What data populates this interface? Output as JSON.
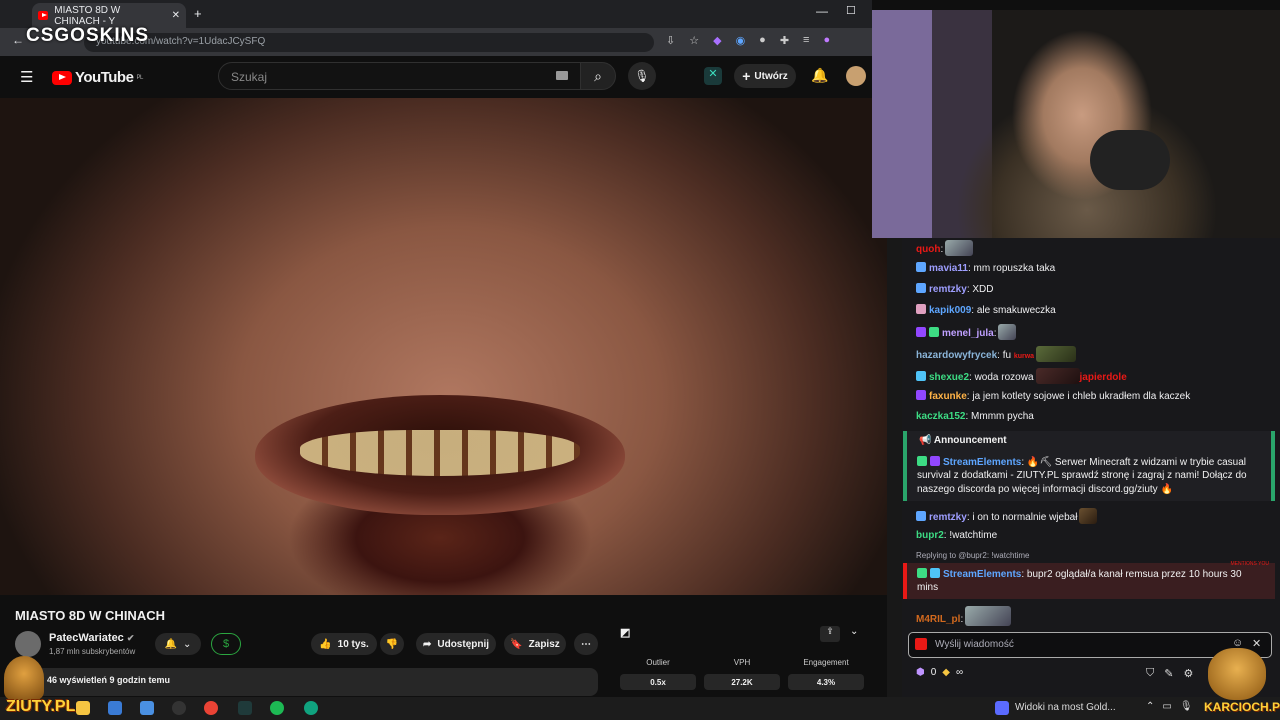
{
  "browser": {
    "tab_title": "MIASTO 8D W CHINACH - Y",
    "url": "youtube.com/watch?v=1UdacJCySFQ",
    "overlay_logo": "CSGOSKINS"
  },
  "youtube": {
    "logo_text": "YouTube",
    "region": "PL",
    "search_placeholder": "Szukaj",
    "create_label": "Utwórz",
    "video": {
      "title": "MIASTO 8D W CHINACH",
      "channel": "PatecWariatec",
      "subscribers": "1,87 mln subskrybentów",
      "likes": "10 tys.",
      "share_label": "Udostępnij",
      "save_label": "Zapisz",
      "views_line": "46 wyświetleń  9 godzin temu"
    },
    "stats": {
      "labels": [
        "Outlier",
        "VPH",
        "Engagement"
      ],
      "values": [
        "0.5x",
        "27.2K",
        "4.3%"
      ]
    }
  },
  "chat": {
    "messages": [
      {
        "user": "quoh",
        "text": ":",
        "color": "#e91916"
      },
      {
        "user": "mavia11",
        "text": ": mm ropuszka taka",
        "color": "#9e9eff"
      },
      {
        "user": "remtzky",
        "text": ": XDD",
        "color": "#9e9eff"
      },
      {
        "user": "kapik009",
        "text": ": ale smakuweczka",
        "color": "#5ea6ff"
      },
      {
        "user": "menel_jula",
        "text": ":",
        "color": "#bfa0ff"
      },
      {
        "user": "hazardowyfrycek",
        "text": ": fu",
        "color": "#8ab4d8"
      },
      {
        "user": "shexue2",
        "text": ": woda rozowa",
        "color": "#3ddc84"
      },
      {
        "user": "faxunke",
        "text": ": ja jem kotlety sojowe i chleb ukradłem dla kaczek",
        "color": "#ffb347"
      },
      {
        "user": "kaczka152",
        "text": ": Mmmm pycha",
        "color": "#3ddc84"
      },
      {
        "user": "remtzky",
        "text": ": i on to normalnie wjebał",
        "color": "#9e9eff"
      },
      {
        "user": "bupr2",
        "text": ": !watchtime",
        "color": "#3ddc84"
      },
      {
        "user": "M4RIL_pl",
        "text": ":",
        "color": "#d2691e"
      }
    ],
    "emote_texts": {
      "kurwa": "kurwa",
      "japierdole": "japierdole"
    },
    "announcement": {
      "title": "Announcement",
      "user": "StreamElements",
      "line1": ": 🔥⛏ Serwer Minecraft z widzami w trybie casual",
      "line2": "survival z dodatkami - ZIUTY.PL sprawdź stronę i zagraj z nami! Dołącz do",
      "line3": "naszego discorda po więcej informacji discord.gg/ziuty 🔥"
    },
    "reply": {
      "context": "Replying to @bupr2: !watchtime",
      "mentions_label": "MENTIONS YOU",
      "user": "StreamElements",
      "line1": ": bupr2 oglądał/a kanał remsua przez 10 hours 30",
      "line2": "mins"
    },
    "input_placeholder": "Wyślij wiadomość",
    "points": "0",
    "infinity": "∞"
  },
  "taskbar": {
    "left_brand": "ZIUTY.PL",
    "right_brand": "KARCIOCH.PL",
    "media_text": "Widoki na most Gold..."
  },
  "colors": {
    "yt_red": "#ff0000",
    "twitch_bg": "#18181b",
    "announce": "#2aa56b",
    "mention": "#e91916"
  }
}
